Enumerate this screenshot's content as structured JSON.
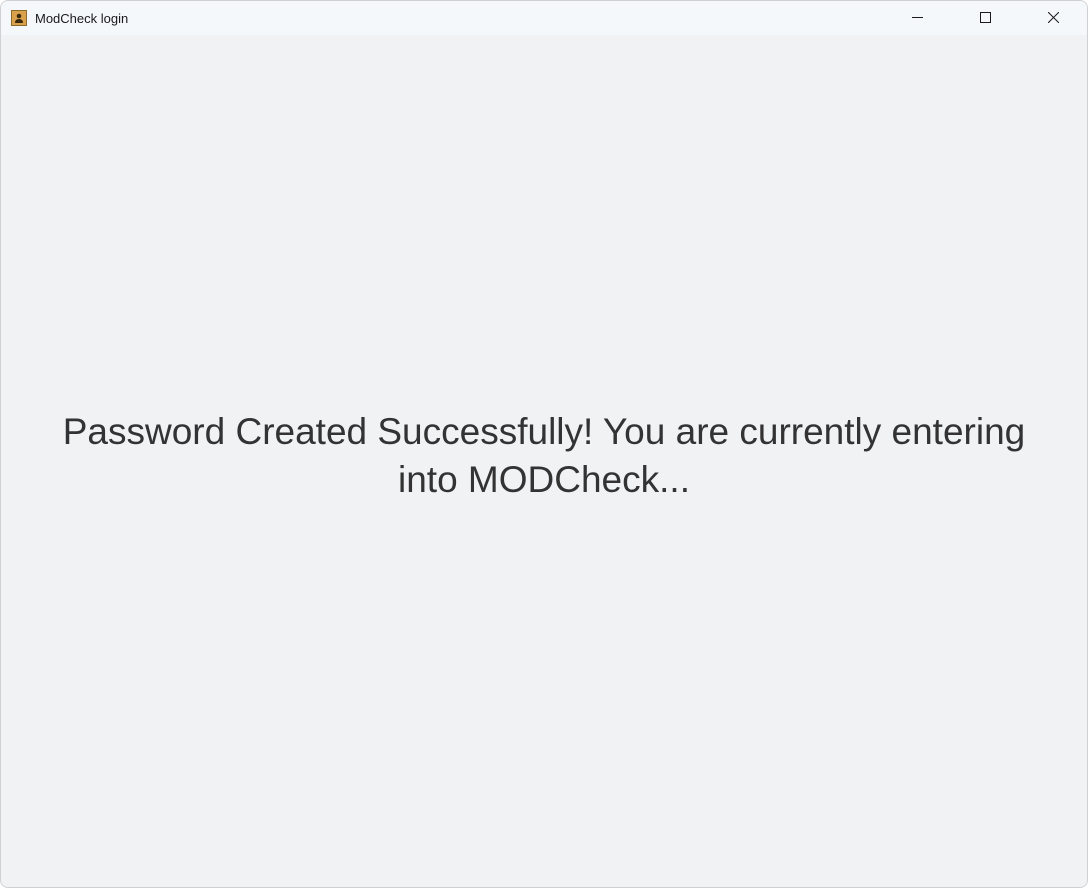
{
  "window": {
    "title": "ModCheck login"
  },
  "content": {
    "message": "Password Created Successfully! You are currently entering into MODCheck..."
  }
}
